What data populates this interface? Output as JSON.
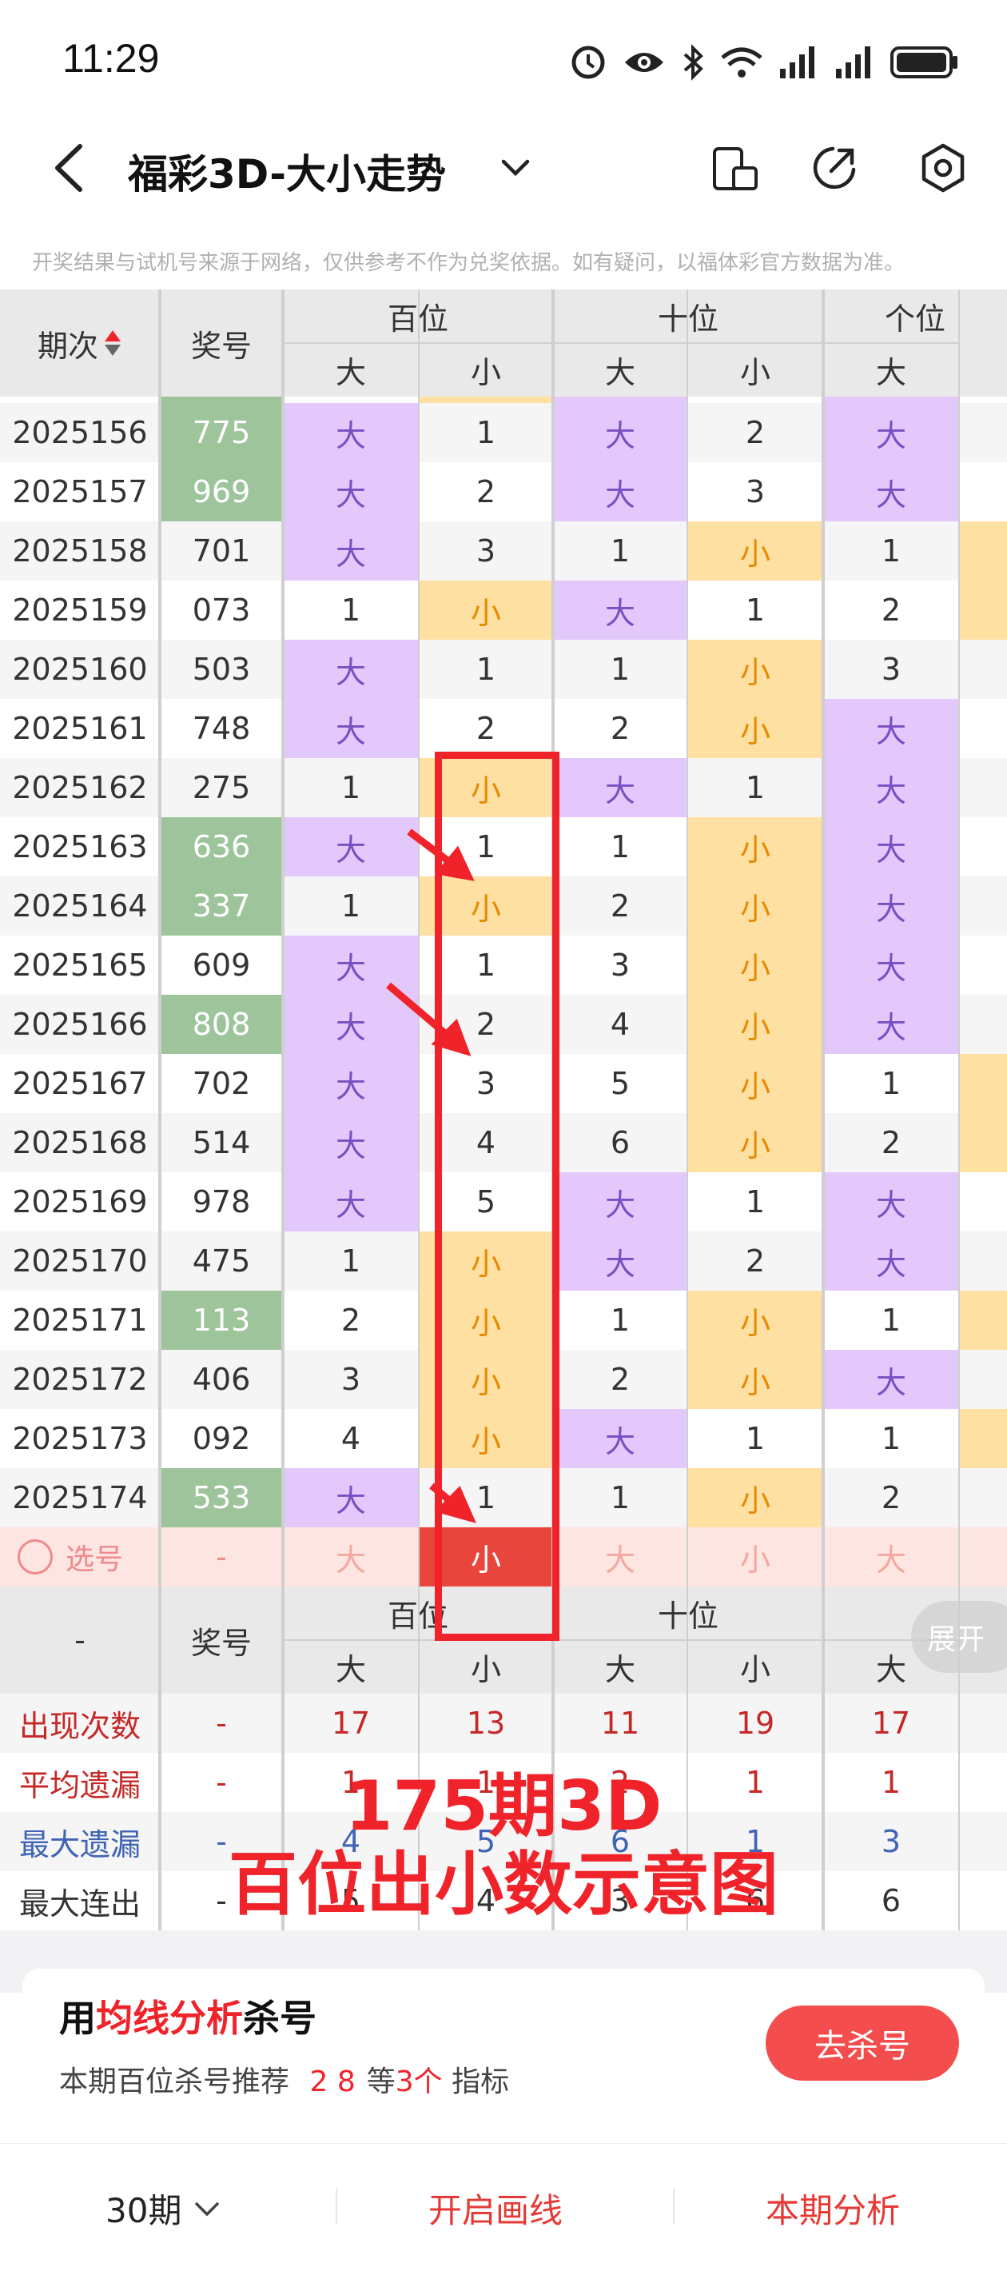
{
  "status_bar": {
    "time": "11:29"
  },
  "header": {
    "title": "福彩3D-大小走势"
  },
  "notice": "开奖结果与试机号来源于网络，仅供参考不作为兑奖依据。如有疑问，以福体彩官方数据为准。",
  "table_header": {
    "period": "期次",
    "prize": "奖号",
    "groups": [
      "百位",
      "十位",
      "个位"
    ],
    "sub": [
      "大",
      "小",
      "大",
      "小",
      "大"
    ]
  },
  "rows": [
    {
      "period": "2025156",
      "prize": "775",
      "hl": true,
      "cells": [
        "大",
        "1",
        "大",
        "2",
        "大"
      ]
    },
    {
      "period": "2025157",
      "prize": "969",
      "hl": true,
      "cells": [
        "大",
        "2",
        "大",
        "3",
        "大"
      ]
    },
    {
      "period": "2025158",
      "prize": "701",
      "hl": false,
      "cells": [
        "大",
        "3",
        "1",
        "小",
        "1"
      ]
    },
    {
      "period": "2025159",
      "prize": "073",
      "hl": false,
      "cells": [
        "1",
        "小",
        "大",
        "1",
        "2"
      ]
    },
    {
      "period": "2025160",
      "prize": "503",
      "hl": false,
      "cells": [
        "大",
        "1",
        "1",
        "小",
        "3"
      ]
    },
    {
      "period": "2025161",
      "prize": "748",
      "hl": false,
      "cells": [
        "大",
        "2",
        "2",
        "小",
        "大"
      ]
    },
    {
      "period": "2025162",
      "prize": "275",
      "hl": false,
      "cells": [
        "1",
        "小",
        "大",
        "1",
        "大"
      ]
    },
    {
      "period": "2025163",
      "prize": "636",
      "hl": true,
      "cells": [
        "大",
        "1",
        "1",
        "小",
        "大"
      ]
    },
    {
      "period": "2025164",
      "prize": "337",
      "hl": true,
      "cells": [
        "1",
        "小",
        "2",
        "小",
        "大"
      ]
    },
    {
      "period": "2025165",
      "prize": "609",
      "hl": false,
      "cells": [
        "大",
        "1",
        "3",
        "小",
        "大"
      ]
    },
    {
      "period": "2025166",
      "prize": "808",
      "hl": true,
      "cells": [
        "大",
        "2",
        "4",
        "小",
        "大"
      ]
    },
    {
      "period": "2025167",
      "prize": "702",
      "hl": false,
      "cells": [
        "大",
        "3",
        "5",
        "小",
        "1"
      ]
    },
    {
      "period": "2025168",
      "prize": "514",
      "hl": false,
      "cells": [
        "大",
        "4",
        "6",
        "小",
        "2"
      ]
    },
    {
      "period": "2025169",
      "prize": "978",
      "hl": false,
      "cells": [
        "大",
        "5",
        "大",
        "1",
        "大"
      ]
    },
    {
      "period": "2025170",
      "prize": "475",
      "hl": false,
      "cells": [
        "1",
        "小",
        "大",
        "2",
        "大"
      ]
    },
    {
      "period": "2025171",
      "prize": "113",
      "hl": true,
      "cells": [
        "2",
        "小",
        "1",
        "小",
        "1"
      ]
    },
    {
      "period": "2025172",
      "prize": "406",
      "hl": false,
      "cells": [
        "3",
        "小",
        "2",
        "小",
        "大"
      ]
    },
    {
      "period": "2025173",
      "prize": "092",
      "hl": false,
      "cells": [
        "4",
        "小",
        "大",
        "1",
        "1"
      ]
    },
    {
      "period": "2025174",
      "prize": "533",
      "hl": true,
      "cells": [
        "大",
        "1",
        "1",
        "小",
        "2"
      ]
    }
  ],
  "select_row": {
    "label": "选号",
    "prize": "-",
    "cells": [
      "大",
      "小",
      "大",
      "小",
      "大"
    ]
  },
  "stats_header": {
    "period": "-",
    "prize": "奖号",
    "groups": [
      "百位",
      "十位"
    ],
    "sub": [
      "大",
      "小",
      "大",
      "小",
      "大"
    ],
    "expand": "展开"
  },
  "stats": [
    {
      "label": "出现次数",
      "prize": "-",
      "values": [
        "17",
        "13",
        "11",
        "19",
        "17"
      ],
      "color": "#c62828"
    },
    {
      "label": "平均遗漏",
      "prize": "-",
      "values": [
        "1",
        "1",
        "2",
        "1",
        "1"
      ],
      "color": "#c62828"
    },
    {
      "label": "最大遗漏",
      "prize": "-",
      "values": [
        "4",
        "5",
        "6",
        "1",
        "3"
      ],
      "color": "#3f63b5"
    },
    {
      "label": "最大连出",
      "prize": "-",
      "values": [
        "5",
        "4",
        "3",
        "6",
        "6"
      ],
      "color": "#333333"
    }
  ],
  "overlay": {
    "line1": "175期3D",
    "line2": "百位出小数示意图"
  },
  "card": {
    "title_prefix": "用",
    "title_highlight": "均线分析",
    "title_suffix": "杀号",
    "sub_prefix": "本期百位杀号推荐",
    "sub_nums": "2 8",
    "sub_mid": "等",
    "sub_count": "3个",
    "sub_suffix": "指标",
    "button": "去杀号"
  },
  "tabbar": {
    "periods": "30期",
    "draw": "开启画线",
    "analysis": "本期分析"
  },
  "colors": {
    "big_bg": "#e3c9fb",
    "small_bg": "#ffe0a3",
    "prize_bg": "#9dc49a",
    "red": "#f0232a",
    "select_bg": "#fde5e2"
  }
}
